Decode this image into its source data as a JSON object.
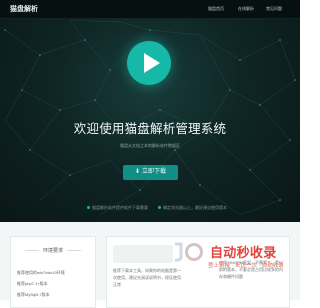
{
  "header": {
    "logo_text": "猫盘解析",
    "nav": [
      "猫盘首页",
      "在线解析",
      "常见问题"
    ]
  },
  "hero": {
    "play_icon": "play-icon",
    "headline": "欢迎使用猫盘解析管理系统",
    "subtitle": "猫盘从文档之本地解析软件数据区",
    "download_label": "立即下载",
    "download_icon": "arrow-down-icon",
    "notes": [
      "猫盘解析软件提供软件下载需要",
      "确定浏览器以上，最好建议使用版本"
    ]
  },
  "lower": {
    "left_card": {
      "title": "环境要求",
      "items": [
        "推荐使用的win7/win10环境",
        "推荐php7.1+版本",
        "推荐MySql5.7版本"
      ]
    },
    "right_card": {
      "text_left": "推荐下载本工具，如果你的电脑是第一次使用，建议先阅读说明书，保证使用正常",
      "text_right": "使用 DNOPM框架，不需要大，是以前的版本，不要总是占用比较多的内存和硬件问题"
    }
  },
  "watermark": {
    "name": "自动秒收录",
    "slogan": "登上链接 · 来访一次 · 自动收录"
  },
  "colors": {
    "accent": "#16b8a8",
    "button": "#118f86",
    "hero_bg": "#0f2525",
    "watermark": "#e3433b"
  }
}
